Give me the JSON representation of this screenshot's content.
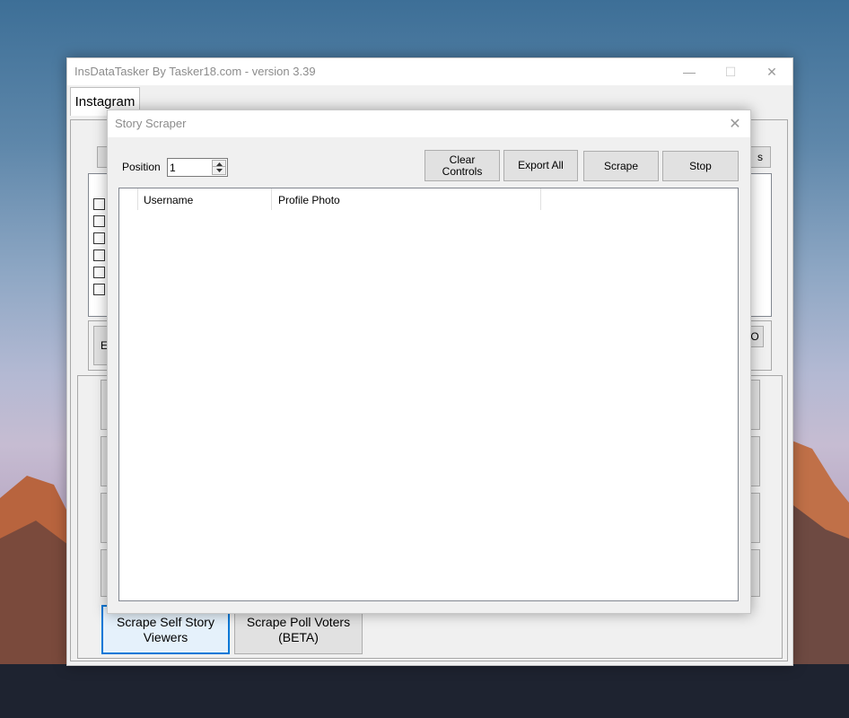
{
  "main_window": {
    "title": "InsDataTasker By Tasker18.com - version 3.39",
    "tab_label": "Instagram",
    "partial_button_right_1": "s",
    "partial_button_right_2": "O",
    "partial_button_left": "E",
    "bottom_buttons": [
      {
        "label": "Scrape Self Story\nViewers"
      },
      {
        "label": "Scrape Poll Voters\n(BETA)"
      }
    ],
    "window_controls": {
      "minimize": "—",
      "maximize": "☐",
      "close": "✕"
    }
  },
  "dialog": {
    "title": "Story Scraper",
    "position_label": "Position",
    "position_value": "1",
    "buttons": {
      "clear_controls": "Clear\nControls",
      "export_all": "Export All",
      "scrape": "Scrape",
      "stop": "Stop"
    },
    "columns": [
      "Username",
      "Profile Photo"
    ],
    "close": "✕"
  }
}
